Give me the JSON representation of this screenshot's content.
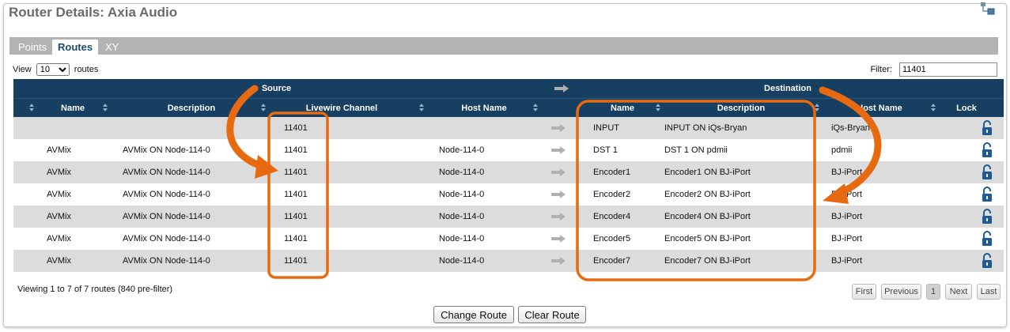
{
  "title": "Router Details: Axia Audio",
  "tabs": [
    {
      "label": "Points",
      "active": false
    },
    {
      "label": "Routes",
      "active": true
    },
    {
      "label": "XY",
      "active": false
    }
  ],
  "view": {
    "prefix": "View",
    "selected": "10",
    "suffix": "routes"
  },
  "filter": {
    "label": "Filter:",
    "value": "11401"
  },
  "groups": {
    "source": "Source",
    "destination": "Destination"
  },
  "columns": {
    "src_name": "Name",
    "src_description": "Description",
    "livewire_channel": "Livewire Channel",
    "host_name": "Host Name",
    "dst_name": "Name",
    "dst_description": "Description",
    "dst_host_name": "Host Name",
    "lock": "Lock"
  },
  "rows": [
    {
      "src_name": "",
      "src_desc": "",
      "channel": "11401",
      "host": "",
      "dst_name": "INPUT",
      "dst_desc": "INPUT ON iQs-Bryan",
      "dst_host": "iQs-Bryan"
    },
    {
      "src_name": "AVMix",
      "src_desc": "AVMix ON Node-114-0",
      "channel": "11401",
      "host": "Node-114-0",
      "dst_name": "DST 1",
      "dst_desc": "DST 1 ON pdmii",
      "dst_host": "pdmii"
    },
    {
      "src_name": "AVMix",
      "src_desc": "AVMix ON Node-114-0",
      "channel": "11401",
      "host": "Node-114-0",
      "dst_name": "Encoder1",
      "dst_desc": "Encoder1 ON BJ-iPort",
      "dst_host": "BJ-iPort"
    },
    {
      "src_name": "AVMix",
      "src_desc": "AVMix ON Node-114-0",
      "channel": "11401",
      "host": "Node-114-0",
      "dst_name": "Encoder2",
      "dst_desc": "Encoder2 ON BJ-iPort",
      "dst_host": "BJ-iPort"
    },
    {
      "src_name": "AVMix",
      "src_desc": "AVMix ON Node-114-0",
      "channel": "11401",
      "host": "Node-114-0",
      "dst_name": "Encoder4",
      "dst_desc": "Encoder4 ON BJ-iPort",
      "dst_host": "BJ-iPort"
    },
    {
      "src_name": "AVMix",
      "src_desc": "AVMix ON Node-114-0",
      "channel": "11401",
      "host": "Node-114-0",
      "dst_name": "Encoder5",
      "dst_desc": "Encoder5 ON BJ-iPort",
      "dst_host": "BJ-iPort"
    },
    {
      "src_name": "AVMix",
      "src_desc": "AVMix ON Node-114-0",
      "channel": "11401",
      "host": "Node-114-0",
      "dst_name": "Encoder7",
      "dst_desc": "Encoder7 ON BJ-iPort",
      "dst_host": "BJ-iPort"
    }
  ],
  "footer": {
    "status": "Viewing 1 to 7 of 7 routes (840 pre-filter)"
  },
  "pagination": {
    "first": "First",
    "previous": "Previous",
    "current": "1",
    "next": "Next",
    "last": "Last"
  },
  "buttons": {
    "change_route": "Change Route",
    "clear_route": "Clear Route"
  },
  "icons": {
    "route_arrow": "right-arrow-icon",
    "lock": "unlocked-padlock-icon",
    "corner": "network-route-icon"
  },
  "colors": {
    "header_bg": "#163f62",
    "alt_row": "#dcdcdc",
    "annotation": "#e86a10",
    "lock_blue": "#1f5a94"
  }
}
